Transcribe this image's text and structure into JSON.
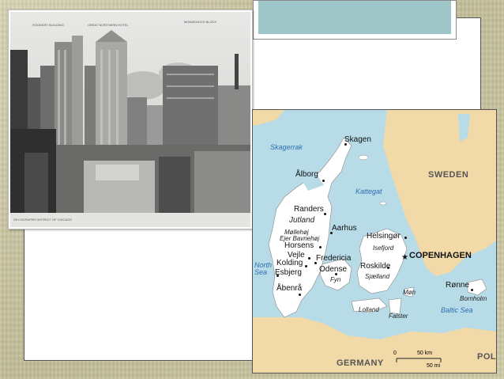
{
  "photo": {
    "caption": "SKY-SCRAPER DISTRICT OF CHICAGO",
    "top_labels": [
      "ROOKERY BUILDING",
      "GREAT NORTHERN HOTEL",
      "MONADNOCK BLOCK"
    ]
  },
  "map": {
    "cities": [
      {
        "id": "skagen",
        "label": "Skagen"
      },
      {
        "id": "aalborg",
        "label": "Ålborg"
      },
      {
        "id": "randers",
        "label": "Randers"
      },
      {
        "id": "aarhus",
        "label": "Aarhus"
      },
      {
        "id": "horsens",
        "label": "Horsens"
      },
      {
        "id": "vejle",
        "label": "Vejle"
      },
      {
        "id": "fredericia",
        "label": "Fredericia"
      },
      {
        "id": "kolding",
        "label": "Kolding"
      },
      {
        "id": "esbjerg",
        "label": "Esbjerg"
      },
      {
        "id": "odense",
        "label": "Odense"
      },
      {
        "id": "abenra",
        "label": "Åbenrå"
      },
      {
        "id": "helsingor",
        "label": "Helsingør"
      },
      {
        "id": "roskilde",
        "label": "Roskilde"
      },
      {
        "id": "ronne",
        "label": "Rønne"
      }
    ],
    "capital": "COPENHAGEN",
    "regions": {
      "jutland": "Jutland",
      "mallehoj": "Møllehøj",
      "ejer_bavnehoj": "Ejer Bavnehøj",
      "fyn": "Fyn",
      "sjaelland": "Sjælland",
      "lolland": "Lolland",
      "falster": "Falster",
      "mon": "Møn",
      "bornholm": "Bornholm",
      "isefjord": "Isefjord"
    },
    "seas": {
      "skagerrak": "Skagerrak",
      "kattegat": "Kattegat",
      "north_sea": "North Sea",
      "baltic_sea": "Baltic Sea"
    },
    "countries": {
      "sweden": "SWEDEN",
      "germany": "GERMANY",
      "poland": "POL"
    },
    "scale": {
      "km": "50 km",
      "mi": "50 mi",
      "zero": "0"
    },
    "colors": {
      "land": "#f2d9a8",
      "water": "#b8dbe8",
      "denmark": "#ffffff"
    }
  }
}
